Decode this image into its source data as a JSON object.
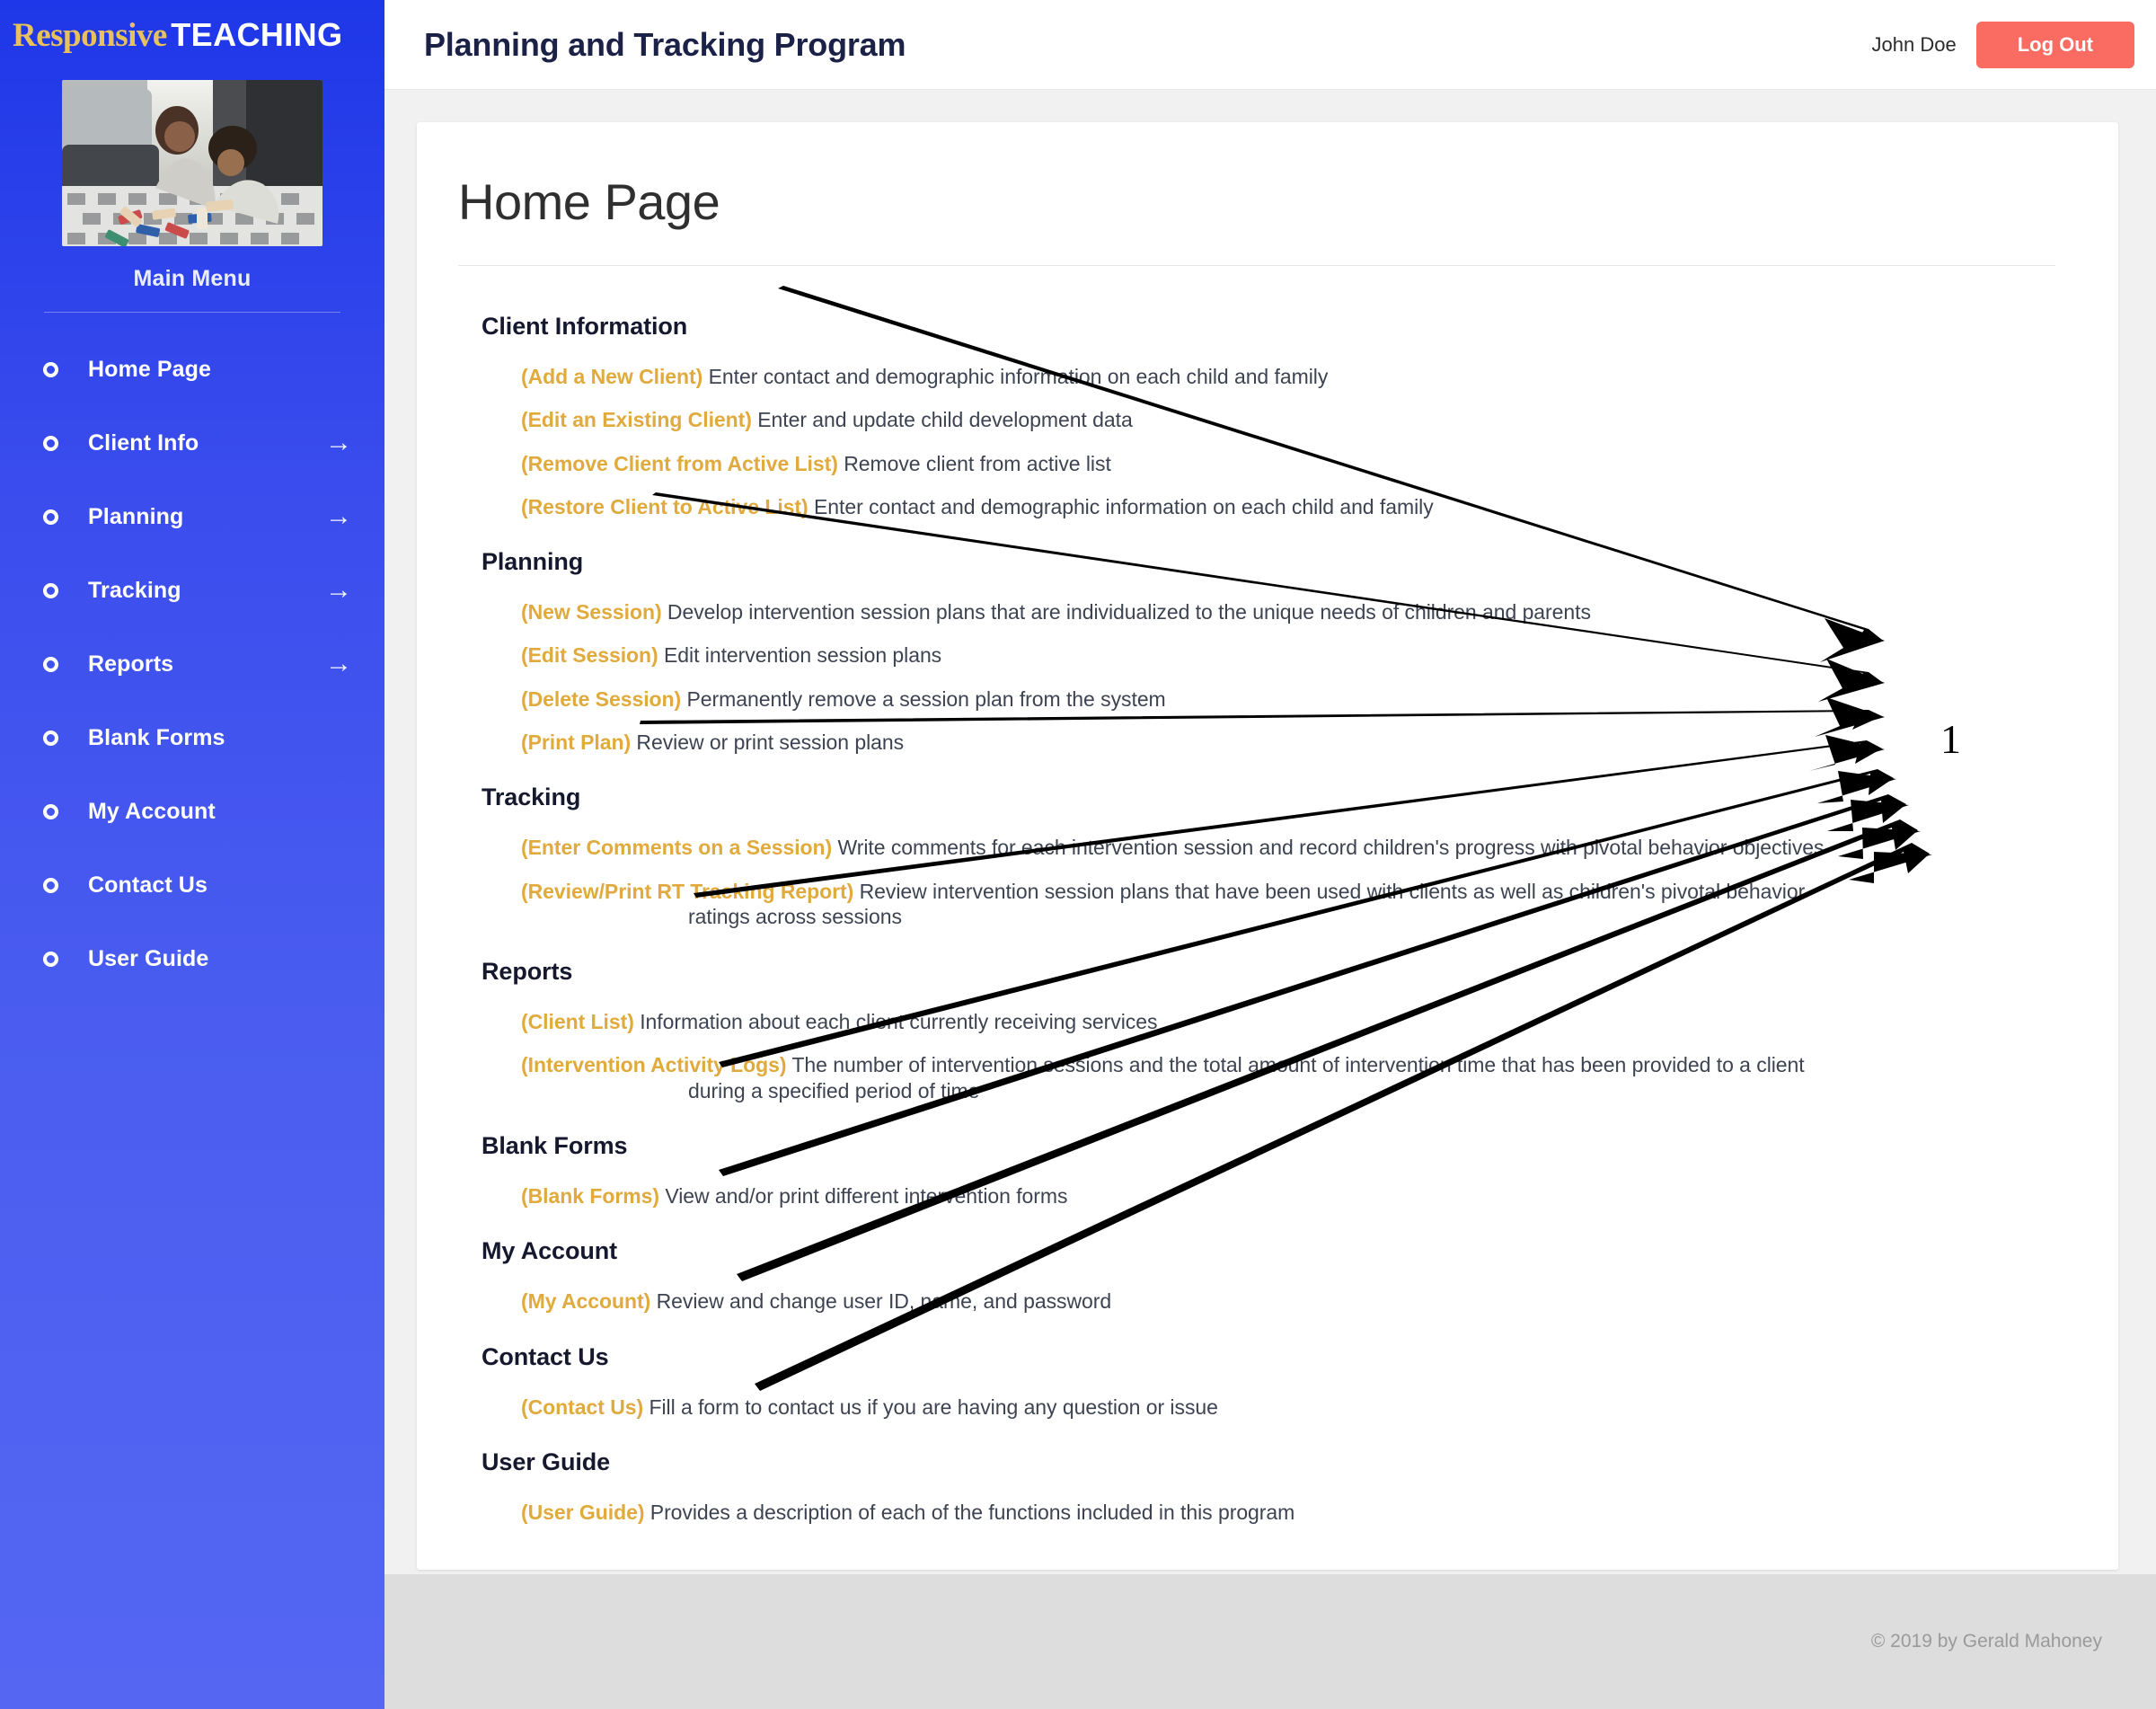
{
  "sidebar": {
    "brand_first": "Responsive",
    "brand_second": "TEACHING",
    "thumb_alt": "mother-and-child-playing-photo",
    "main_menu_label": "Main Menu",
    "items": [
      {
        "label": "Home Page",
        "arrow": ""
      },
      {
        "label": "Client Info",
        "arrow": "→"
      },
      {
        "label": "Planning",
        "arrow": "→"
      },
      {
        "label": "Tracking",
        "arrow": "→"
      },
      {
        "label": "Reports",
        "arrow": "→"
      },
      {
        "label": "Blank Forms",
        "arrow": ""
      },
      {
        "label": "My Account",
        "arrow": ""
      },
      {
        "label": "Contact Us",
        "arrow": ""
      },
      {
        "label": "User Guide",
        "arrow": ""
      }
    ]
  },
  "topbar": {
    "app_title": "Planning and Tracking Program",
    "username": "John Doe",
    "logout_label": "Log Out"
  },
  "main": {
    "page_title": "Home Page",
    "sections": [
      {
        "heading": "Client Information",
        "items": [
          {
            "key": "(Add a New Client)",
            "desc": "Enter contact and demographic information on each child and family",
            "cont": ""
          },
          {
            "key": "(Edit an Existing Client)",
            "desc": "Enter and update child development data",
            "cont": ""
          },
          {
            "key": "(Remove Client from Active List)",
            "desc": "Remove client from active list",
            "cont": ""
          },
          {
            "key": "(Restore Client to Active List)",
            "desc": "Enter contact and demographic information on each child and family",
            "cont": ""
          }
        ]
      },
      {
        "heading": "Planning",
        "items": [
          {
            "key": "(New Session)",
            "desc": "Develop intervention session plans that are individualized to the unique needs of children and parents",
            "cont": ""
          },
          {
            "key": "(Edit Session)",
            "desc": "Edit intervention session plans",
            "cont": ""
          },
          {
            "key": "(Delete Session)",
            "desc": "Permanently remove a session plan from the system",
            "cont": ""
          },
          {
            "key": "(Print Plan)",
            "desc": "Review or print session plans",
            "cont": ""
          }
        ]
      },
      {
        "heading": "Tracking",
        "items": [
          {
            "key": "(Enter Comments on a Session)",
            "desc": "Write comments for each intervention session and record children's progress with pivotal behavior objectives",
            "cont": ""
          },
          {
            "key": "(Review/Print RT Tracking Report)",
            "desc": "Review intervention session plans that have been used with clients as well as children's pivotal behavior",
            "cont": "ratings across sessions"
          }
        ]
      },
      {
        "heading": "Reports",
        "items": [
          {
            "key": "(Client List)",
            "desc": "Information about each client currently receiving services",
            "cont": ""
          },
          {
            "key": "(Intervention Activity Logs)",
            "desc": "The number of intervention sessions and the total amount of intervention time that has been provided to a client",
            "cont": "during a specified period of time"
          }
        ]
      },
      {
        "heading": "Blank Forms",
        "items": [
          {
            "key": "(Blank Forms)",
            "desc": "View and/or print different intervention forms",
            "cont": ""
          }
        ]
      },
      {
        "heading": "My Account",
        "items": [
          {
            "key": "(My Account)",
            "desc": "Review and change user ID, name, and password",
            "cont": ""
          }
        ]
      },
      {
        "heading": "Contact Us",
        "items": [
          {
            "key": "(Contact Us)",
            "desc": "Fill a form to contact us if you are having any question or issue",
            "cont": ""
          }
        ]
      },
      {
        "heading": "User Guide",
        "items": [
          {
            "key": "(User Guide)",
            "desc": "Provides a description of each of the functions included in this program",
            "cont": ""
          }
        ]
      }
    ]
  },
  "footer": {
    "copyright": "© 2019 by Gerald Mahoney"
  },
  "annotation": {
    "number": "1",
    "arrow_count": 8,
    "arrow_color": "#000000",
    "description": "Eight tapered arrows drawn from each section heading converging to the right toward the label 1"
  },
  "colors": {
    "sidebar_top": "#1e37e8",
    "sidebar_bottom": "#5466f2",
    "accent_gold": "#e0aa3c",
    "brand_gold": "#e8c15f",
    "logout_red": "#fa6b61",
    "page_bg": "#f1f1f1",
    "footer_bg": "#dddddd",
    "heading_dark": "#16182e"
  }
}
